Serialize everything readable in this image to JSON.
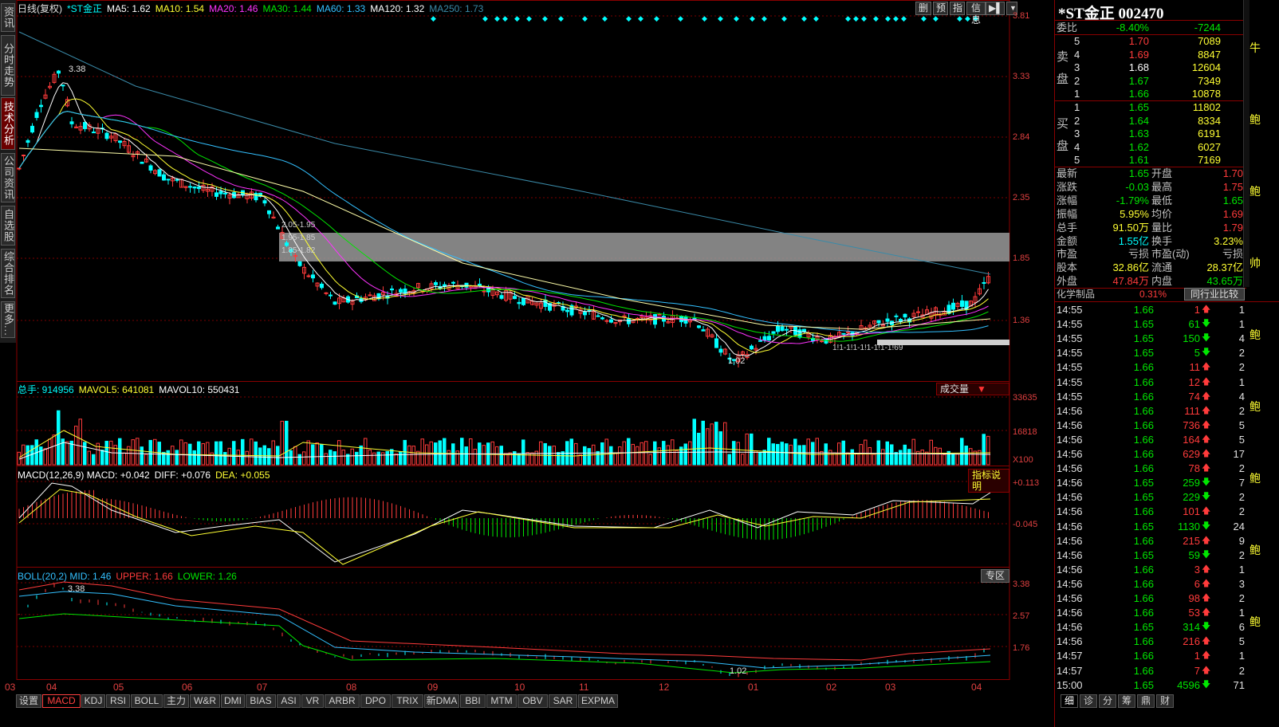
{
  "sidebar": {
    "tabs": [
      {
        "label": "资讯"
      },
      {
        "label": "分时走势"
      },
      {
        "label": "技术分析"
      },
      {
        "label": "公司资讯"
      },
      {
        "label": "自选股"
      },
      {
        "label": "综合排名"
      },
      {
        "label": "更多..."
      }
    ]
  },
  "price_panel": {
    "period": "日线(复权)",
    "name": "*ST金正",
    "ma": [
      {
        "label": "MA5: 1.62",
        "color": "#ffffff"
      },
      {
        "label": "MA10: 1.54",
        "color": "#ffff33"
      },
      {
        "label": "MA20: 1.46",
        "color": "#ff33ff"
      },
      {
        "label": "MA30: 1.44",
        "color": "#00e600"
      },
      {
        "label": "MA60: 1.33",
        "color": "#33c0ff"
      },
      {
        "label": "MA120: 1.32",
        "color": "#ffffff"
      },
      {
        "label": "MA250: 1.73",
        "color": "#3a8aa8"
      }
    ],
    "buttons": [
      "删",
      "预",
      "指",
      "信息"
    ],
    "right_axis": [
      "3.81",
      "3.33",
      "2.84",
      "2.35",
      "1.85",
      "1.36"
    ],
    "annotations": {
      "high": "3.38",
      "low": "1.02",
      "zone": [
        "2.05-1.95",
        "1.95-1.85",
        "1.85-1.82"
      ],
      "small": "1!1-1!1-1!1-1!1-1!69"
    }
  },
  "volume_panel": {
    "legend": [
      {
        "label": "总手: 914956",
        "color": "#00ffff"
      },
      {
        "label": "MAVOL5: 641081",
        "color": "#ffff33"
      },
      {
        "label": "MAVOL10: 550431",
        "color": "#ffffff"
      }
    ],
    "selector": "成交量",
    "right_axis": [
      "33635",
      "16818"
    ],
    "unit": "X100"
  },
  "macd_panel": {
    "legend": [
      {
        "label": "MACD(12,26,9) MACD: +0.042",
        "color": "#ffffff"
      },
      {
        "label": "DIFF: +0.076",
        "color": "#ffffff"
      },
      {
        "label": "DEA: +0.055",
        "color": "#ffff33"
      }
    ],
    "help": "指标说明",
    "right_axis": [
      "+0.113",
      "-0.045"
    ]
  },
  "boll_panel": {
    "legend": [
      {
        "label": "BOLL(20,2) MID: 1.46",
        "color": "#33c0ff"
      },
      {
        "label": "UPPER: 1.66",
        "color": "#ff3b3b"
      },
      {
        "label": "LOWER: 1.26",
        "color": "#00e600"
      }
    ],
    "button": "专区",
    "right_axis": [
      "3.38",
      "2.57",
      "1.76"
    ],
    "annotations": {
      "high": "3.38",
      "low": "1.02"
    }
  },
  "x_axis": [
    "03",
    "04",
    "05",
    "06",
    "07",
    "08",
    "09",
    "10",
    "11",
    "12",
    "01",
    "02",
    "03",
    "04"
  ],
  "bottom_tabs": [
    "设置",
    "MACD",
    "KDJ",
    "RSI",
    "BOLL",
    "主力",
    "W&R",
    "DMI",
    "BIAS",
    "ASI",
    "VR",
    "ARBR",
    "DPO",
    "TRIX",
    "新DMA",
    "BBI",
    "MTM",
    "OBV",
    "SAR",
    "EXPMA"
  ],
  "quote": {
    "title": "*ST金正 002470",
    "ratio": {
      "label": "委比",
      "value": "-8.40%",
      "diff": "-7244"
    },
    "sell_label": "卖盘",
    "buy_label": "买盘",
    "sell": [
      {
        "level": "5",
        "price": "1.70",
        "vol": "7089",
        "pc": "red"
      },
      {
        "level": "4",
        "price": "1.69",
        "vol": "8847",
        "pc": "red"
      },
      {
        "level": "3",
        "price": "1.68",
        "vol": "12604",
        "pc": "wht"
      },
      {
        "level": "2",
        "price": "1.67",
        "vol": "7349",
        "pc": "grn"
      },
      {
        "level": "1",
        "price": "1.66",
        "vol": "10878",
        "pc": "grn"
      }
    ],
    "buy": [
      {
        "level": "1",
        "price": "1.65",
        "vol": "11802",
        "pc": "grn"
      },
      {
        "level": "2",
        "price": "1.64",
        "vol": "8334",
        "pc": "grn"
      },
      {
        "level": "3",
        "price": "1.63",
        "vol": "6191",
        "pc": "grn"
      },
      {
        "level": "4",
        "price": "1.62",
        "vol": "6027",
        "pc": "grn"
      },
      {
        "level": "5",
        "price": "1.61",
        "vol": "7169",
        "pc": "grn"
      }
    ],
    "stats": [
      {
        "l1": "最新",
        "v1": "1.65",
        "c1": "grn",
        "l2": "开盘",
        "v2": "1.70",
        "c2": "red"
      },
      {
        "l1": "涨跌",
        "v1": "-0.03",
        "c1": "grn",
        "l2": "最高",
        "v2": "1.75",
        "c2": "red"
      },
      {
        "l1": "涨幅",
        "v1": "-1.79%",
        "c1": "grn",
        "l2": "最低",
        "v2": "1.65",
        "c2": "grn"
      },
      {
        "l1": "振幅",
        "v1": "5.95%",
        "c1": "yel",
        "l2": "均价",
        "v2": "1.69",
        "c2": "red"
      },
      {
        "l1": "总手",
        "v1": "91.50万",
        "c1": "yel",
        "l2": "量比",
        "v2": "1.79",
        "c2": "red"
      },
      {
        "l1": "金额",
        "v1": "1.55亿",
        "c1": "cyan",
        "l2": "换手",
        "v2": "3.23%",
        "c2": "yel"
      },
      {
        "l1": "市盈",
        "v1": "亏损",
        "c1": "gry",
        "l2": "市盈(动)",
        "v2": "亏损",
        "c2": "gry"
      },
      {
        "l1": "股本",
        "v1": "32.86亿",
        "c1": "yel",
        "l2": "流通",
        "v2": "28.37亿",
        "c2": "yel"
      },
      {
        "l1": "外盘",
        "v1": "47.84万",
        "c1": "red",
        "l2": "内盘",
        "v2": "43.65万",
        "c2": "grn"
      }
    ],
    "sector": {
      "name": "化学制品",
      "change": "0.31%",
      "button": "同行业比较"
    },
    "ticks": [
      {
        "t": "14:55",
        "p": "1.66",
        "pc": "grn",
        "v": "1",
        "d": "up",
        "x": "1"
      },
      {
        "t": "14:55",
        "p": "1.65",
        "pc": "grn",
        "v": "61",
        "d": "down",
        "x": "1"
      },
      {
        "t": "14:55",
        "p": "1.65",
        "pc": "grn",
        "v": "150",
        "d": "down",
        "x": "4"
      },
      {
        "t": "14:55",
        "p": "1.65",
        "pc": "grn",
        "v": "5",
        "d": "down",
        "x": "2"
      },
      {
        "t": "14:55",
        "p": "1.66",
        "pc": "grn",
        "v": "11",
        "d": "up",
        "x": "2"
      },
      {
        "t": "14:55",
        "p": "1.66",
        "pc": "grn",
        "v": "12",
        "d": "up",
        "x": "1"
      },
      {
        "t": "14:55",
        "p": "1.66",
        "pc": "grn",
        "v": "74",
        "d": "up",
        "x": "4"
      },
      {
        "t": "14:56",
        "p": "1.66",
        "pc": "grn",
        "v": "111",
        "d": "up",
        "x": "2"
      },
      {
        "t": "14:56",
        "p": "1.66",
        "pc": "grn",
        "v": "736",
        "d": "up",
        "x": "5"
      },
      {
        "t": "14:56",
        "p": "1.66",
        "pc": "grn",
        "v": "164",
        "d": "up",
        "x": "5"
      },
      {
        "t": "14:56",
        "p": "1.66",
        "pc": "grn",
        "v": "629",
        "d": "up",
        "x": "17"
      },
      {
        "t": "14:56",
        "p": "1.66",
        "pc": "grn",
        "v": "78",
        "d": "up",
        "x": "2"
      },
      {
        "t": "14:56",
        "p": "1.65",
        "pc": "grn",
        "v": "259",
        "d": "down",
        "x": "7"
      },
      {
        "t": "14:56",
        "p": "1.65",
        "pc": "grn",
        "v": "229",
        "d": "down",
        "x": "2"
      },
      {
        "t": "14:56",
        "p": "1.66",
        "pc": "grn",
        "v": "101",
        "d": "up",
        "x": "2"
      },
      {
        "t": "14:56",
        "p": "1.65",
        "pc": "grn",
        "v": "1130",
        "d": "down",
        "x": "24"
      },
      {
        "t": "14:56",
        "p": "1.66",
        "pc": "grn",
        "v": "215",
        "d": "up",
        "x": "9"
      },
      {
        "t": "14:56",
        "p": "1.65",
        "pc": "grn",
        "v": "59",
        "d": "down",
        "x": "2"
      },
      {
        "t": "14:56",
        "p": "1.66",
        "pc": "grn",
        "v": "3",
        "d": "up",
        "x": "1"
      },
      {
        "t": "14:56",
        "p": "1.66",
        "pc": "grn",
        "v": "6",
        "d": "up",
        "x": "3"
      },
      {
        "t": "14:56",
        "p": "1.66",
        "pc": "grn",
        "v": "98",
        "d": "up",
        "x": "2"
      },
      {
        "t": "14:56",
        "p": "1.66",
        "pc": "grn",
        "v": "53",
        "d": "up",
        "x": "1"
      },
      {
        "t": "14:56",
        "p": "1.65",
        "pc": "grn",
        "v": "314",
        "d": "down",
        "x": "6"
      },
      {
        "t": "14:56",
        "p": "1.66",
        "pc": "grn",
        "v": "216",
        "d": "up",
        "x": "5"
      },
      {
        "t": "14:57",
        "p": "1.66",
        "pc": "grn",
        "v": "1",
        "d": "up",
        "x": "1"
      },
      {
        "t": "14:57",
        "p": "1.66",
        "pc": "grn",
        "v": "7",
        "d": "up",
        "x": "2"
      },
      {
        "t": "15:00",
        "p": "1.65",
        "pc": "grn",
        "v": "4596",
        "d": "down",
        "x": "71"
      }
    ],
    "side_chars": [
      "牛",
      "鲍",
      "鲍",
      "帅",
      "鲍",
      "鲍",
      "鲍",
      "鲍",
      "鲍"
    ],
    "right_tabs": [
      "细",
      "诊",
      "分",
      "筹",
      "鼎",
      "财"
    ]
  }
}
